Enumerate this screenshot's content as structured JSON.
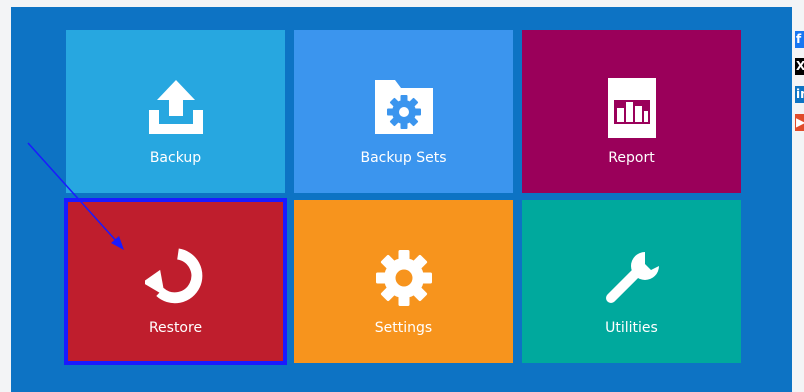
{
  "colors": {
    "backup": "#27a7e0",
    "backup_sets": "#3b95ee",
    "report": "#9a005a",
    "restore": "#bf1e2d",
    "settings": "#f7941d",
    "utilities": "#00a99d",
    "panel": "#0d73c4",
    "selection": "#1a1aff"
  },
  "tiles": [
    {
      "id": "backup",
      "label": "Backup",
      "icon": "upload-tray-icon"
    },
    {
      "id": "backup_sets",
      "label": "Backup Sets",
      "icon": "folder-gear-icon"
    },
    {
      "id": "report",
      "label": "Report",
      "icon": "bar-chart-icon"
    },
    {
      "id": "restore",
      "label": "Restore",
      "icon": "restore-arrow-icon",
      "selected": true
    },
    {
      "id": "settings",
      "label": "Settings",
      "icon": "gear-icon"
    },
    {
      "id": "utilities",
      "label": "Utilities",
      "icon": "wrench-icon"
    }
  ],
  "social": [
    {
      "name": "facebook",
      "glyph": "f",
      "icon": "facebook-icon"
    },
    {
      "name": "x",
      "glyph": "X",
      "icon": "x-icon"
    },
    {
      "name": "linkedin",
      "glyph": "in",
      "icon": "linkedin-icon"
    },
    {
      "name": "youtube",
      "glyph": "▶",
      "icon": "youtube-icon"
    }
  ]
}
